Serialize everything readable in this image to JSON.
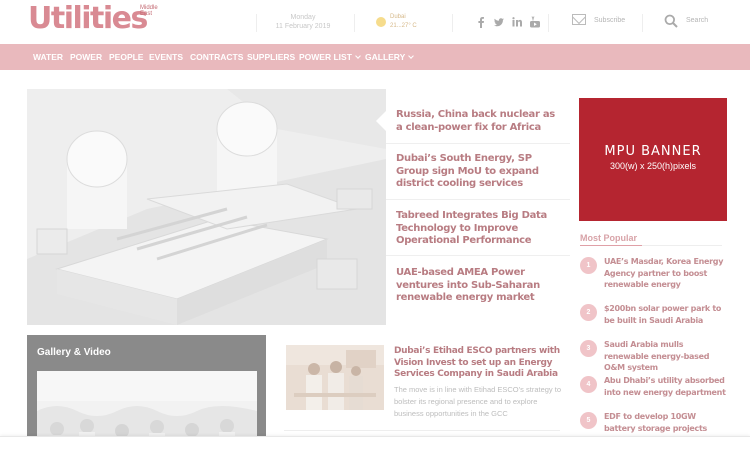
{
  "header": {
    "logo_text": "Utilities",
    "logo_region": "Middle East",
    "date_day": "Monday",
    "date_full": "11 February 2019",
    "weather_city": "Dubai",
    "weather_temp": "21...27° C",
    "subscribe_label": "Subscribe",
    "search_label": "Search"
  },
  "nav": {
    "items": [
      {
        "label": "WATER"
      },
      {
        "label": "POWER"
      },
      {
        "label": "PEOPLE"
      },
      {
        "label": "EVENTS"
      },
      {
        "label": "CONTRACTS"
      },
      {
        "label": "SUPPLIERS"
      },
      {
        "label": "POWER LIST"
      },
      {
        "label": "GALLERY"
      }
    ]
  },
  "hero": {
    "headlines": [
      "Russia, China back nuclear as a clean-power fix for Africa",
      "Dubai’s South Energy, SP Group sign MoU to expand district cooling services",
      "Tabreed Integrates Big Data Technology to Improve Operational Performance",
      "UAE-based AMEA Power ventures into Sub-Saharan renewable energy market"
    ]
  },
  "gallery": {
    "title": "Gallery & Video"
  },
  "article": {
    "title": "Dubai’s Etihad ESCO partners with Vision Invest to set up an Energy Services Company in Saudi Arabia",
    "description": "The move is in line with Etihad ESCO’s strategy to bolster its regional presence and to explore business opportunities in the GCC"
  },
  "mpu": {
    "title": "MPU BANNER",
    "subtitle": "300(w) x 250(h)pixels"
  },
  "most_popular": {
    "title": "Most Popular",
    "items": [
      {
        "num": "1",
        "text": "UAE’s Masdar, Korea Energy Agency partner to boost renewable energy"
      },
      {
        "num": "2",
        "text": "$200bn solar power park to be built in Saudi Arabia"
      },
      {
        "num": "3",
        "text": "Saudi Arabia mulls renewable energy-based O&M system"
      },
      {
        "num": "4",
        "text": "Abu Dhabi’s utility absorbed into new energy department"
      },
      {
        "num": "5",
        "text": "EDF to develop 10GW battery storage projects"
      }
    ]
  },
  "colors": {
    "brand": "#d98a93",
    "nav_bg": "#e9b9bd",
    "mpu_bg": "#b52530",
    "headline": "#b87c82"
  },
  "icons": [
    "facebook-icon",
    "twitter-icon",
    "linkedin-icon",
    "youtube-icon",
    "mail-icon",
    "search-icon",
    "sun-icon"
  ]
}
